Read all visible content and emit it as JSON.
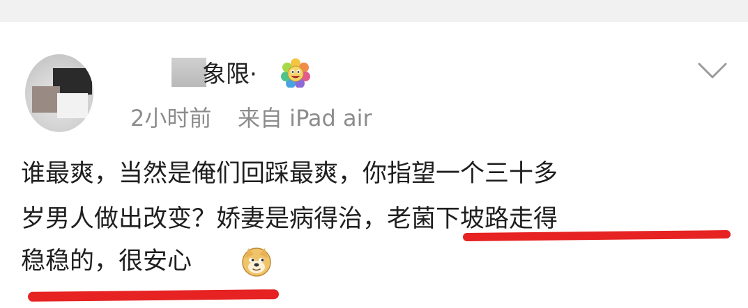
{
  "post": {
    "user": {
      "name_visible": "象限·",
      "badge_icon": "sunflower-face-icon"
    },
    "meta": {
      "time": "2小时前",
      "source": "来自 iPad air"
    },
    "content": {
      "line1": "谁最爽，当然是俺们回踩最爽，你指望一个三十多",
      "line2": "岁男人做出改变？娇妻是病得治，老菌下坡路走得",
      "line3": "稳稳的，很安心",
      "emoji_icon": "doge-icon"
    },
    "menu_icon": "chevron-down-icon"
  },
  "colors": {
    "text": "#1f1f1f",
    "meta": "#8c8c8c",
    "underline": "#e62222",
    "page_gap": "#f1f1f1"
  }
}
